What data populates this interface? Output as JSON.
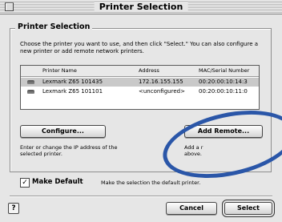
{
  "window": {
    "title": "Printer Selection"
  },
  "group": {
    "title": "Printer Selection",
    "instructions": "Choose the printer you want to use, and then click \"Select.\" You can also configure a new printer or add remote network printers."
  },
  "table": {
    "headers": [
      "Printer Name",
      "Address",
      "MAC/Serial Number"
    ],
    "rows": [
      {
        "name": "Lexmark Z65 101435",
        "address": "172.16.155.155",
        "mac": "00:20:00:10:14:3"
      },
      {
        "name": "Lexmark Z65 101101",
        "address": "<unconfigured>",
        "mac": "00:20:00:10:11:0"
      }
    ]
  },
  "configure": {
    "label": "Configure...",
    "desc": "Enter or change the IP address of the selected printer."
  },
  "add_remote": {
    "label": "Add Remote...",
    "desc_visible_1": "Add a r",
    "desc_visible_2": "above."
  },
  "make_default": {
    "checked": "✓",
    "label": "Make Default",
    "desc": "Make the selection the default printer."
  },
  "footer": {
    "help": "?",
    "cancel": "Cancel",
    "select": "Select"
  },
  "annotation_color": "#2a56a8"
}
